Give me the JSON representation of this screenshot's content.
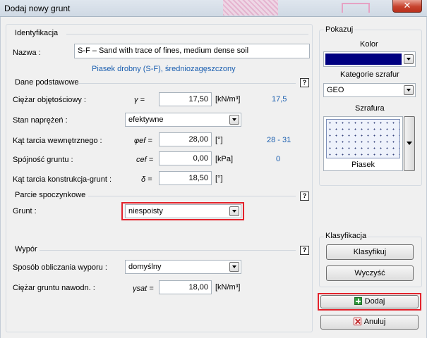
{
  "window": {
    "title": "Dodaj nowy grunt",
    "close_glyph": "✕"
  },
  "identification": {
    "header": "Identyfikacja",
    "name_label": "Nazwa :",
    "name_value": "S-F – Sand with trace of fines, medium dense soil",
    "subtitle": "Piasek drobny (S-F), średniozagęszczony"
  },
  "basic": {
    "header": "Dane podstawowe",
    "help_glyph": "?",
    "rows": [
      {
        "label": "Ciężar objętościowy :",
        "symbol": "γ =",
        "value": "17,50",
        "unit": "[kN/m³]",
        "hint": "17,5"
      },
      {
        "label": "Stan naprężeń :",
        "select": "efektywne"
      },
      {
        "label": "Kąt tarcia wewnętrznego :",
        "symbol": "φef =",
        "value": "28,00",
        "unit": "[°]",
        "hint": "28 - 31"
      },
      {
        "label": "Spójność gruntu :",
        "symbol": "cef =",
        "value": "0,00",
        "unit": "[kPa]",
        "hint": "0"
      },
      {
        "label": "Kąt tarcia konstrukcja-grunt :",
        "symbol": "δ =",
        "value": "18,50",
        "unit": "[°]",
        "hint": ""
      }
    ]
  },
  "rest": {
    "header": "Parcie spoczynkowe",
    "help_glyph": "?",
    "soil_label": "Grunt :",
    "soil_value": "niespoisty"
  },
  "uplift": {
    "header": "Wypór",
    "help_glyph": "?",
    "method_label": "Sposób obliczania wyporu :",
    "method_value": "domyślny",
    "sat_label": "Ciężar gruntu nawodn. :",
    "sat_symbol": "γsat =",
    "sat_value": "18,00",
    "sat_unit": "[kN/m³]"
  },
  "display": {
    "header": "Pokazuj",
    "color_label": "Kolor",
    "color_value": "#000080",
    "category_label": "Kategorie szrafur",
    "category_value": "GEO",
    "hatch_label": "Szrafura",
    "hatch_name": "Piasek"
  },
  "classification": {
    "header": "Klasyfikacja",
    "classify_button": "Klasyfikuj",
    "clear_button": "Wyczyść"
  },
  "actions": {
    "add_button": "Dodaj",
    "cancel_button": "Anuluj",
    "add_icon": "plus-icon",
    "cancel_icon": "x-icon"
  },
  "colors": {
    "highlight": "#e3222b",
    "hint_blue": "#1b5fb0"
  }
}
